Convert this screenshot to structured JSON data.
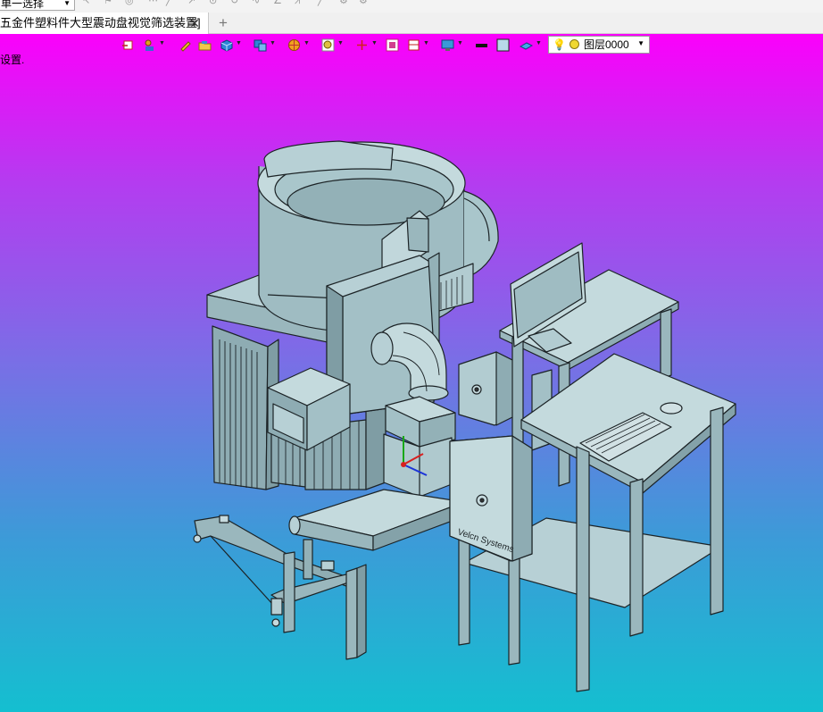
{
  "app": {
    "selection_filter": "单一选择",
    "tab": {
      "title": "五金件塑料件大型震动盘视觉筛选装置]"
    },
    "status_message": "设置."
  },
  "toolbar": {
    "icons": [
      "exit-sketch-icon",
      "user-view-icon",
      "pencil-icon",
      "folder-open-icon",
      "solid-cube-icon",
      "multi-cube-icon",
      "shaded-sphere-icon",
      "zoom-icon",
      "triad-icon",
      "fit-view-icon",
      "section-view-icon",
      "display-monitor-icon",
      "line-style-icon",
      "color-swatch-icon",
      "plane-icon"
    ],
    "layer": {
      "name": "图层0000"
    }
  },
  "model": {
    "controller_label": "Velcn Systems",
    "colors": {
      "stroke": "#1c2326",
      "face_light": "#b4cfd4",
      "face_mid": "#9ab7bd",
      "face_dark": "#7f9da4"
    }
  }
}
